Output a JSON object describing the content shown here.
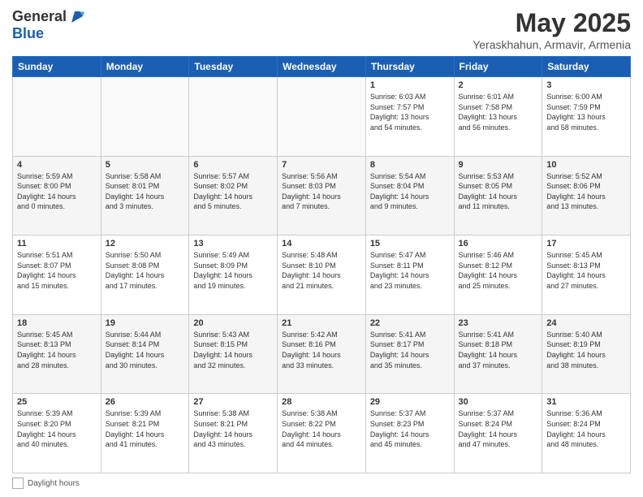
{
  "header": {
    "logo_line1": "General",
    "logo_line2": "Blue",
    "month": "May 2025",
    "location": "Yeraskhahun, Armavir, Armenia"
  },
  "days_of_week": [
    "Sunday",
    "Monday",
    "Tuesday",
    "Wednesday",
    "Thursday",
    "Friday",
    "Saturday"
  ],
  "weeks": [
    [
      {
        "day": "",
        "info": ""
      },
      {
        "day": "",
        "info": ""
      },
      {
        "day": "",
        "info": ""
      },
      {
        "day": "",
        "info": ""
      },
      {
        "day": "1",
        "info": "Sunrise: 6:03 AM\nSunset: 7:57 PM\nDaylight: 13 hours\nand 54 minutes."
      },
      {
        "day": "2",
        "info": "Sunrise: 6:01 AM\nSunset: 7:58 PM\nDaylight: 13 hours\nand 56 minutes."
      },
      {
        "day": "3",
        "info": "Sunrise: 6:00 AM\nSunset: 7:59 PM\nDaylight: 13 hours\nand 58 minutes."
      }
    ],
    [
      {
        "day": "4",
        "info": "Sunrise: 5:59 AM\nSunset: 8:00 PM\nDaylight: 14 hours\nand 0 minutes."
      },
      {
        "day": "5",
        "info": "Sunrise: 5:58 AM\nSunset: 8:01 PM\nDaylight: 14 hours\nand 3 minutes."
      },
      {
        "day": "6",
        "info": "Sunrise: 5:57 AM\nSunset: 8:02 PM\nDaylight: 14 hours\nand 5 minutes."
      },
      {
        "day": "7",
        "info": "Sunrise: 5:56 AM\nSunset: 8:03 PM\nDaylight: 14 hours\nand 7 minutes."
      },
      {
        "day": "8",
        "info": "Sunrise: 5:54 AM\nSunset: 8:04 PM\nDaylight: 14 hours\nand 9 minutes."
      },
      {
        "day": "9",
        "info": "Sunrise: 5:53 AM\nSunset: 8:05 PM\nDaylight: 14 hours\nand 11 minutes."
      },
      {
        "day": "10",
        "info": "Sunrise: 5:52 AM\nSunset: 8:06 PM\nDaylight: 14 hours\nand 13 minutes."
      }
    ],
    [
      {
        "day": "11",
        "info": "Sunrise: 5:51 AM\nSunset: 8:07 PM\nDaylight: 14 hours\nand 15 minutes."
      },
      {
        "day": "12",
        "info": "Sunrise: 5:50 AM\nSunset: 8:08 PM\nDaylight: 14 hours\nand 17 minutes."
      },
      {
        "day": "13",
        "info": "Sunrise: 5:49 AM\nSunset: 8:09 PM\nDaylight: 14 hours\nand 19 minutes."
      },
      {
        "day": "14",
        "info": "Sunrise: 5:48 AM\nSunset: 8:10 PM\nDaylight: 14 hours\nand 21 minutes."
      },
      {
        "day": "15",
        "info": "Sunrise: 5:47 AM\nSunset: 8:11 PM\nDaylight: 14 hours\nand 23 minutes."
      },
      {
        "day": "16",
        "info": "Sunrise: 5:46 AM\nSunset: 8:12 PM\nDaylight: 14 hours\nand 25 minutes."
      },
      {
        "day": "17",
        "info": "Sunrise: 5:45 AM\nSunset: 8:13 PM\nDaylight: 14 hours\nand 27 minutes."
      }
    ],
    [
      {
        "day": "18",
        "info": "Sunrise: 5:45 AM\nSunset: 8:13 PM\nDaylight: 14 hours\nand 28 minutes."
      },
      {
        "day": "19",
        "info": "Sunrise: 5:44 AM\nSunset: 8:14 PM\nDaylight: 14 hours\nand 30 minutes."
      },
      {
        "day": "20",
        "info": "Sunrise: 5:43 AM\nSunset: 8:15 PM\nDaylight: 14 hours\nand 32 minutes."
      },
      {
        "day": "21",
        "info": "Sunrise: 5:42 AM\nSunset: 8:16 PM\nDaylight: 14 hours\nand 33 minutes."
      },
      {
        "day": "22",
        "info": "Sunrise: 5:41 AM\nSunset: 8:17 PM\nDaylight: 14 hours\nand 35 minutes."
      },
      {
        "day": "23",
        "info": "Sunrise: 5:41 AM\nSunset: 8:18 PM\nDaylight: 14 hours\nand 37 minutes."
      },
      {
        "day": "24",
        "info": "Sunrise: 5:40 AM\nSunset: 8:19 PM\nDaylight: 14 hours\nand 38 minutes."
      }
    ],
    [
      {
        "day": "25",
        "info": "Sunrise: 5:39 AM\nSunset: 8:20 PM\nDaylight: 14 hours\nand 40 minutes."
      },
      {
        "day": "26",
        "info": "Sunrise: 5:39 AM\nSunset: 8:21 PM\nDaylight: 14 hours\nand 41 minutes."
      },
      {
        "day": "27",
        "info": "Sunrise: 5:38 AM\nSunset: 8:21 PM\nDaylight: 14 hours\nand 43 minutes."
      },
      {
        "day": "28",
        "info": "Sunrise: 5:38 AM\nSunset: 8:22 PM\nDaylight: 14 hours\nand 44 minutes."
      },
      {
        "day": "29",
        "info": "Sunrise: 5:37 AM\nSunset: 8:23 PM\nDaylight: 14 hours\nand 45 minutes."
      },
      {
        "day": "30",
        "info": "Sunrise: 5:37 AM\nSunset: 8:24 PM\nDaylight: 14 hours\nand 47 minutes."
      },
      {
        "day": "31",
        "info": "Sunrise: 5:36 AM\nSunset: 8:24 PM\nDaylight: 14 hours\nand 48 minutes."
      }
    ]
  ],
  "footer": {
    "label": "Daylight hours"
  }
}
